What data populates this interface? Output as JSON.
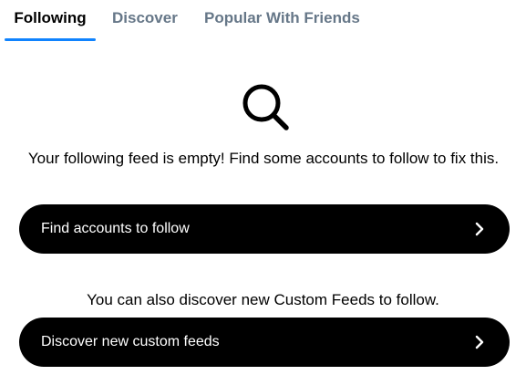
{
  "tabs": {
    "following": "Following",
    "discover": "Discover",
    "popular": "Popular With Friends"
  },
  "colors": {
    "accent": "#1083fe",
    "inactive_tab": "#667788",
    "button_bg": "#000000",
    "button_text": "#ffffff"
  },
  "empty_state": {
    "icon": "search-icon",
    "message": "Your following feed is empty! Find some accounts to follow to fix this.",
    "find_button_label": "Find accounts to follow",
    "also_message": "You can also discover new Custom Feeds to follow.",
    "discover_button_label": "Discover new custom feeds",
    "button_icon": "chevron-right-icon"
  }
}
